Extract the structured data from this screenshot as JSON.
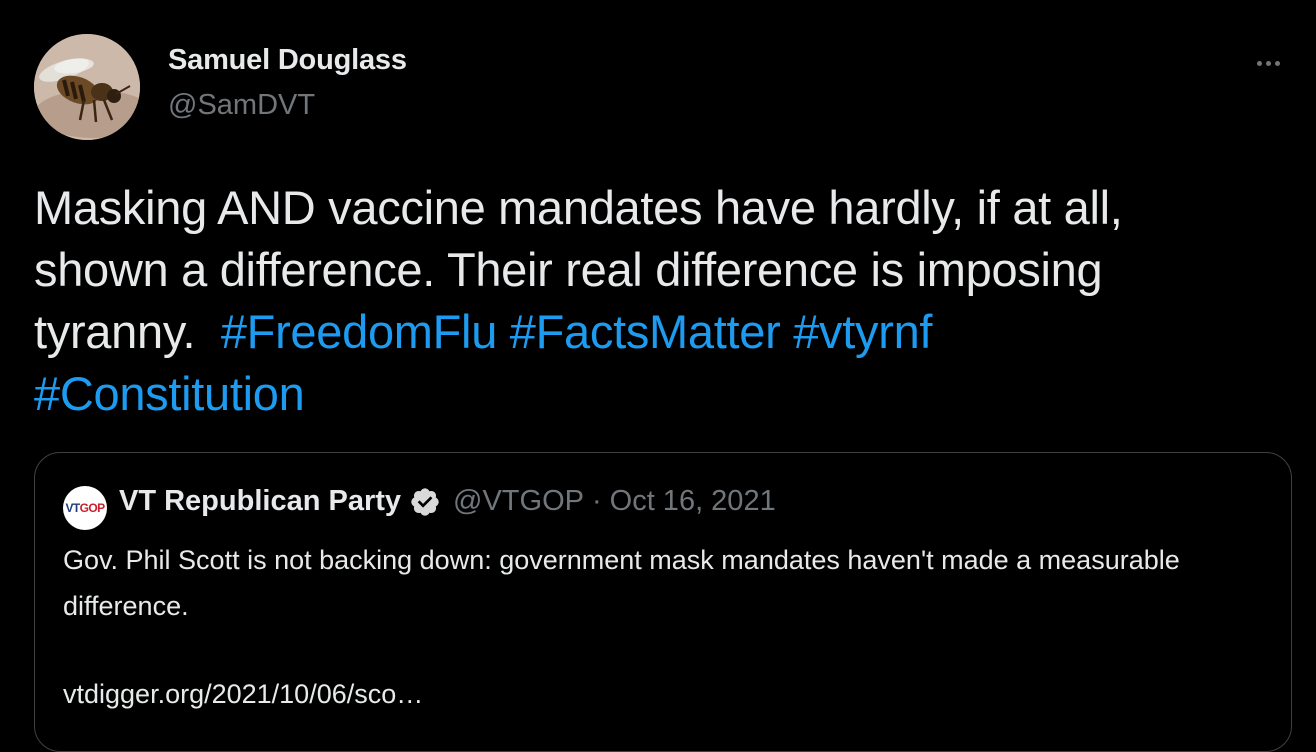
{
  "author": {
    "name": "Samuel Douglass",
    "handle": "@SamDVT",
    "avatar_icon": "bee-avatar"
  },
  "more_icon": "more-options-icon",
  "tweet": {
    "text_line1": "Masking AND vaccine mandates have hardly, if at all,",
    "text_line2": "shown a difference.  Their real difference is imposing",
    "text_line3": "tyranny.  ",
    "hashtags": [
      "#FreedomFlu",
      "#FactsMatter",
      "#vtyrnf",
      "#Constitution"
    ]
  },
  "quoted_tweet": {
    "logo_text_vt": "VT",
    "logo_text_gop": "GOP",
    "name": "VT Republican Party",
    "verified_icon": "verified-badge-icon",
    "handle": "@VTGOP",
    "separator": "·",
    "date": "Oct 16, 2021",
    "text": "Gov. Phil Scott is not backing down: government mask mandates haven't made a measurable difference.",
    "link": "vtdigger.org/2021/10/06/sco…"
  },
  "colors": {
    "background": "#000000",
    "text": "#e7e9ea",
    "secondary": "#71767b",
    "link": "#1d9bf0",
    "border": "#3e4144"
  }
}
